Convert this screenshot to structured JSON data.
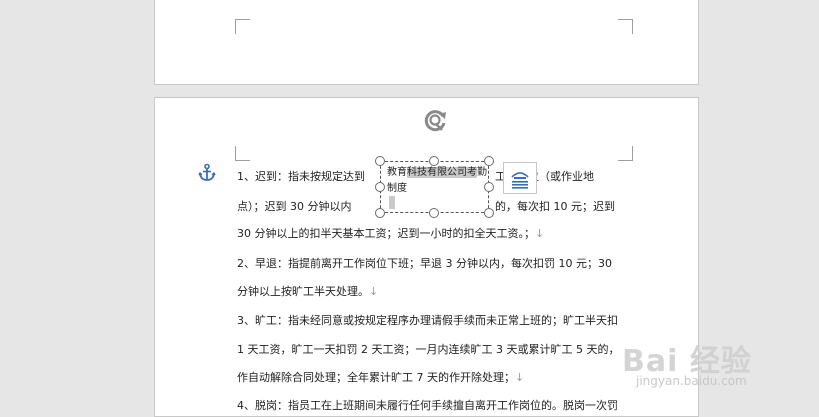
{
  "document": {
    "lines": [
      {
        "before": "1、迟到：指未按规定达到",
        "after": "工作岗位（或作业地"
      },
      {
        "before": "点）；迟到 30 分钟以内",
        "after": "的，每次扣 10 元；迟到"
      },
      {
        "text": "30 分钟以上的扣半天基本工资；迟到一小时的扣全天工资。；",
        "mark": "↓"
      },
      {
        "text": "2、早退：指提前离开工作岗位下班；早退 3 分钟以内，每次扣罚 10 元；30"
      },
      {
        "text": "分钟以上按旷工半天处理。",
        "mark": "↓"
      },
      {
        "text": "3、旷工：指未经同意或按规定程序办理请假手续而未正常上班的；旷工半天扣"
      },
      {
        "text": "1 天工资，旷工一天扣罚 2 天工资；一月内连续旷工 3 天或累计旷工 5 天的，"
      },
      {
        "text": "作自动解除合同处理；全年累计旷工 7 天的作开除处理；",
        "mark": "↓"
      },
      {
        "text": "4、脱岗：指员工在上班期间未履行任何手续擅自离开工作岗位的。脱岗一次罚"
      }
    ]
  },
  "textbox": {
    "prefix": "教育",
    "selected": "科技有限公司考",
    "suffix": "勤制度"
  },
  "icons": {
    "anchor": "anchor-icon",
    "rotate": "rotate-handle-icon",
    "layout_options": "layout-options-icon"
  },
  "colors": {
    "anchor": "#3c6eb4",
    "selection": "#c9c9c9"
  },
  "watermark": {
    "title": "Bai 经验",
    "url": "jingyan.baidu.com"
  }
}
